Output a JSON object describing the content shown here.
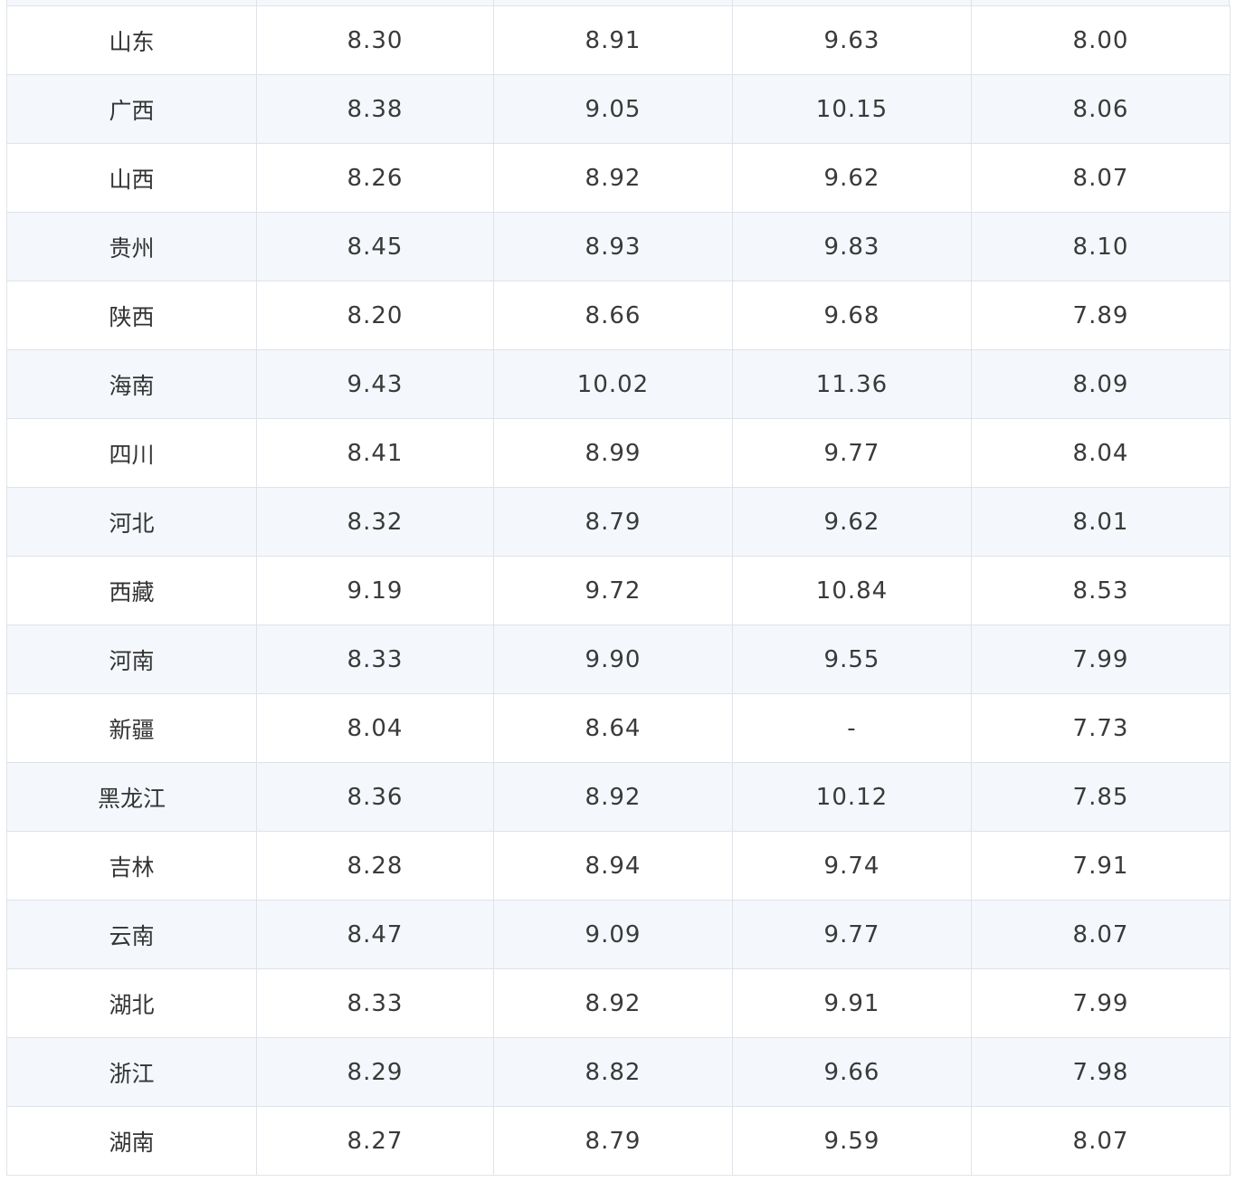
{
  "table": {
    "rows": [
      {
        "province": "山东",
        "v1": "8.30",
        "v2": "8.91",
        "v3": "9.63",
        "v4": "8.00"
      },
      {
        "province": "广西",
        "v1": "8.38",
        "v2": "9.05",
        "v3": "10.15",
        "v4": "8.06"
      },
      {
        "province": "山西",
        "v1": "8.26",
        "v2": "8.92",
        "v3": "9.62",
        "v4": "8.07"
      },
      {
        "province": "贵州",
        "v1": "8.45",
        "v2": "8.93",
        "v3": "9.83",
        "v4": "8.10"
      },
      {
        "province": "陕西",
        "v1": "8.20",
        "v2": "8.66",
        "v3": "9.68",
        "v4": "7.89"
      },
      {
        "province": "海南",
        "v1": "9.43",
        "v2": "10.02",
        "v3": "11.36",
        "v4": "8.09"
      },
      {
        "province": "四川",
        "v1": "8.41",
        "v2": "8.99",
        "v3": "9.77",
        "v4": "8.04"
      },
      {
        "province": "河北",
        "v1": "8.32",
        "v2": "8.79",
        "v3": "9.62",
        "v4": "8.01"
      },
      {
        "province": "西藏",
        "v1": "9.19",
        "v2": "9.72",
        "v3": "10.84",
        "v4": "8.53"
      },
      {
        "province": "河南",
        "v1": "8.33",
        "v2": "9.90",
        "v3": "9.55",
        "v4": "7.99"
      },
      {
        "province": "新疆",
        "v1": "8.04",
        "v2": "8.64",
        "v3": "-",
        "v4": "7.73"
      },
      {
        "province": "黑龙江",
        "v1": "8.36",
        "v2": "8.92",
        "v3": "10.12",
        "v4": "7.85"
      },
      {
        "province": "吉林",
        "v1": "8.28",
        "v2": "8.94",
        "v3": "9.74",
        "v4": "7.91"
      },
      {
        "province": "云南",
        "v1": "8.47",
        "v2": "9.09",
        "v3": "9.77",
        "v4": "8.07"
      },
      {
        "province": "湖北",
        "v1": "8.33",
        "v2": "8.92",
        "v3": "9.91",
        "v4": "7.99"
      },
      {
        "province": "浙江",
        "v1": "8.29",
        "v2": "8.82",
        "v3": "9.66",
        "v4": "7.98"
      },
      {
        "province": "湖南",
        "v1": "8.27",
        "v2": "8.79",
        "v3": "9.59",
        "v4": "8.07"
      }
    ]
  },
  "colors": {
    "row_stripe": "#f4f8fc",
    "row_plain": "#ffffff",
    "border": "#dfe3e8",
    "text": "#3a3a3a"
  }
}
